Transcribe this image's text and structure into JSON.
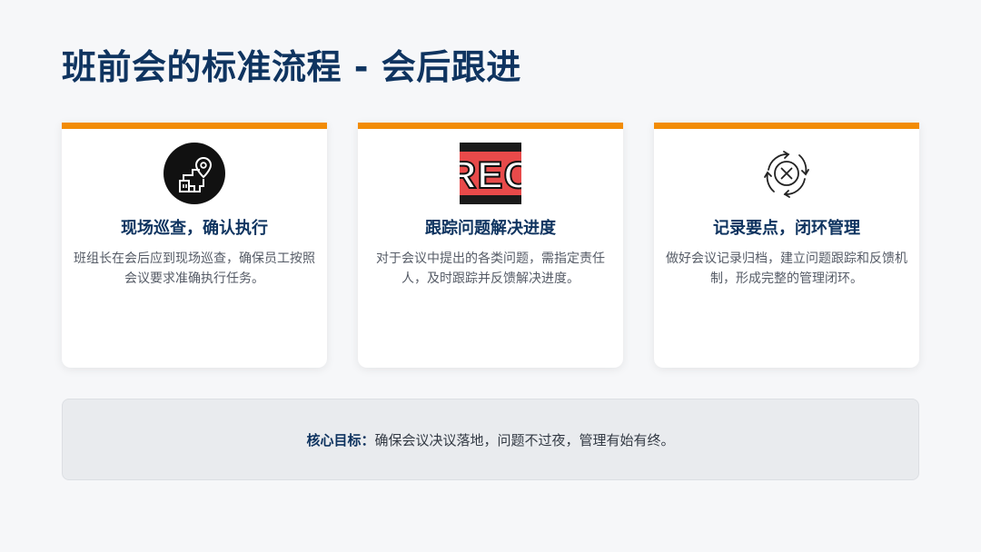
{
  "slide": {
    "title": "班前会的标准流程 - 会后跟进"
  },
  "cards": [
    {
      "title": "现场巡查，确认执行",
      "desc": "班组长在会后应到现场巡查，确保员工按照会议要求准确执行任务。",
      "icon": "site-inspection-location-icon"
    },
    {
      "title": "跟踪问题解决进度",
      "desc": "对于会议中提出的各类问题，需指定责任人，及时跟踪并反馈解决进度。",
      "icon": "rec-record-icon",
      "icon_text": "REC"
    },
    {
      "title": "记录要点，闭环管理",
      "desc": "做好会议记录归档，建立问题跟踪和反馈机制，形成完整的管理闭环。",
      "icon": "cycle-close-icon"
    }
  ],
  "goal": {
    "label": "核心目标：",
    "text": "确保会议决议落地，问题不过夜，管理有始有终。"
  },
  "colors": {
    "title": "#0f3460",
    "accent": "#f28c06",
    "rec_red": "#e84a4a"
  }
}
